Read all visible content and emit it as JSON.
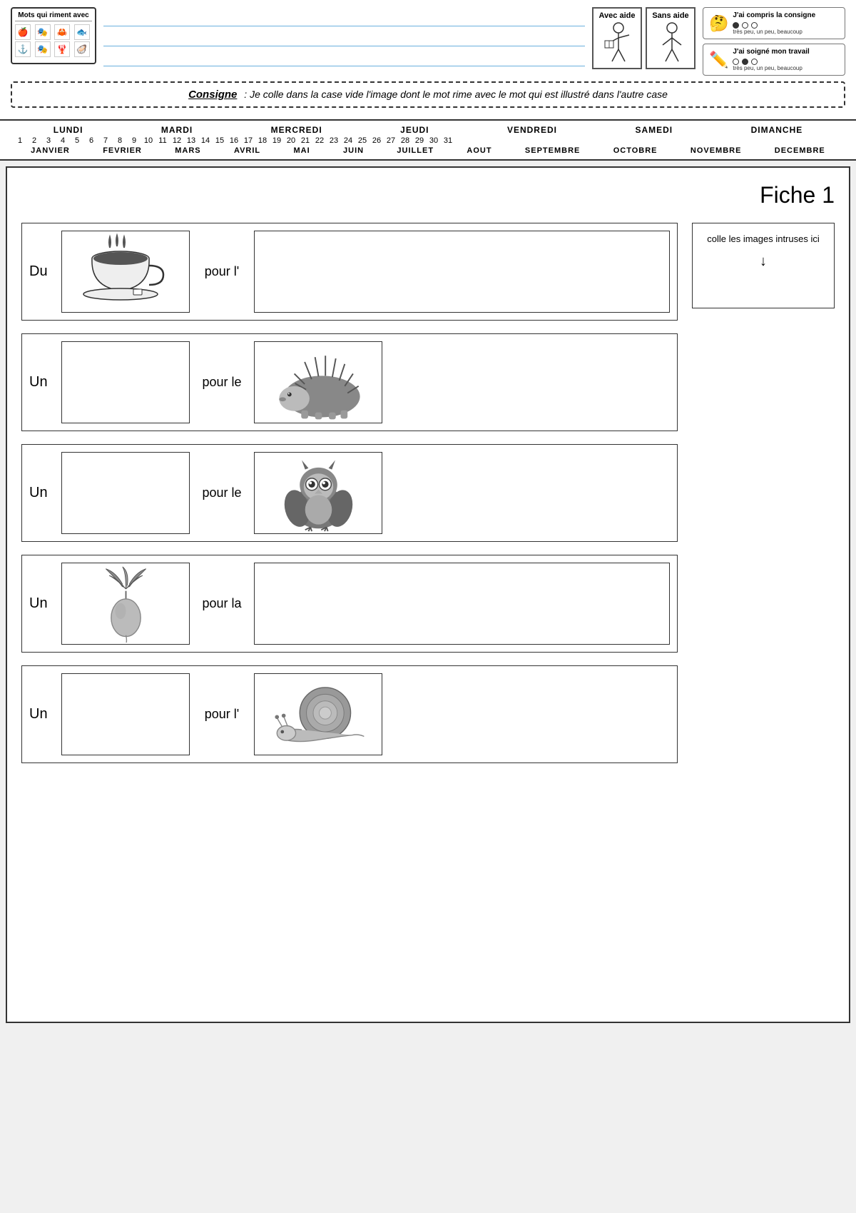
{
  "header": {
    "mots_title": "Mots qui riment avec",
    "icons": [
      "🍎",
      "🎭",
      "🦀",
      "🐠",
      "⚓",
      "🎭",
      "🦞",
      "🦪"
    ],
    "avec_aide": "Avec aide",
    "sans_aide": "Sans aide",
    "rating1_title": "J'ai compris la consigne",
    "rating2_title": "J'ai soigné mon travail",
    "dot_labels": "très peu, un peu, beaucoup"
  },
  "consigne": {
    "label": "Consigne",
    "text": ": Je colle dans la case vide l'image dont le mot rime avec le mot qui est illustré dans l'autre case"
  },
  "calendar": {
    "days": [
      "LUNDI",
      "MARDI",
      "MERCREDI",
      "JEUDI",
      "VENDREDI",
      "SAMEDI",
      "DIMANCHE"
    ],
    "numbers": [
      "1",
      "2",
      "3",
      "4",
      "5",
      "6",
      "7",
      "8",
      "9",
      "10",
      "11",
      "12",
      "13",
      "14",
      "15",
      "16",
      "17",
      "18",
      "19",
      "20",
      "21",
      "22",
      "23",
      "24",
      "25",
      "26",
      "27",
      "28",
      "29",
      "30",
      "31"
    ],
    "months": [
      "JANVIER",
      "FEVRIER",
      "MARS",
      "AVRIL",
      "MAI",
      "JUIN",
      "JUILLET",
      "AOUT",
      "SEPTEMBRE",
      "OCTOBRE",
      "NOVEMBRE",
      "DECEMBRE"
    ]
  },
  "fiche": {
    "title": "Fiche 1",
    "colle_label": "colle les images intruses ici",
    "colle_arrow": "↓",
    "rows": [
      {
        "article": "Du",
        "pour": "pour l'",
        "has_left_image": true,
        "has_right_image": false,
        "image_side": "left"
      },
      {
        "article": "Un",
        "pour": "pour le",
        "has_left_image": false,
        "has_right_image": true,
        "image_side": "right"
      },
      {
        "article": "Un",
        "pour": "pour le",
        "has_left_image": false,
        "has_right_image": true,
        "image_side": "right"
      },
      {
        "article": "Un",
        "pour": "pour la",
        "has_left_image": true,
        "has_right_image": false,
        "image_side": "left"
      },
      {
        "article": "Un",
        "pour": "pour l'",
        "has_left_image": false,
        "has_right_image": true,
        "image_side": "right"
      }
    ]
  }
}
